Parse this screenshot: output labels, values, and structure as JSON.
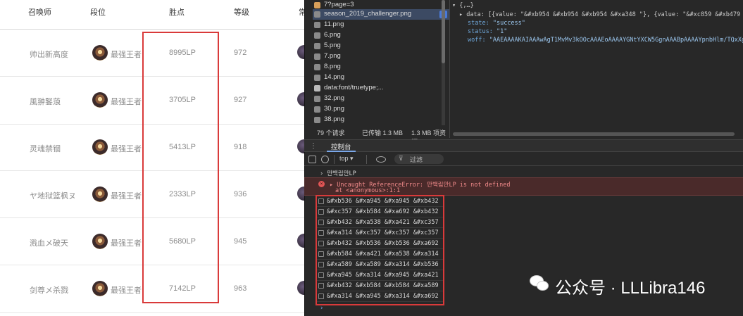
{
  "table": {
    "headers": [
      "召唤师",
      "段位",
      "胜点",
      "等级",
      "常"
    ],
    "rows": [
      {
        "name": "帅出新高度",
        "tier": "最强王者",
        "lp": "8995LP",
        "level": "972"
      },
      {
        "name": "風翀鋻蒗",
        "tier": "最强王者",
        "lp": "3705LP",
        "level": "927"
      },
      {
        "name": "灵魂禁锢",
        "tier": "最强王者",
        "lp": "5413LP",
        "level": "918"
      },
      {
        "name": "ヤ地狱篮枫ヌ",
        "tier": "最强王者",
        "lp": "2333LP",
        "level": "936"
      },
      {
        "name": "溅血メ破天",
        "tier": "最强王者",
        "lp": "5680LP",
        "level": "945"
      },
      {
        "name": "剑尊メ杀戮",
        "tier": "最强王者",
        "lp": "7142LP",
        "level": "963"
      }
    ]
  },
  "network": {
    "items": [
      {
        "name": "7?page=3",
        "icon": "request-icon"
      },
      {
        "name": "season_2019_challenger.png",
        "icon": "image-icon",
        "selected": true
      },
      {
        "name": "11.png",
        "icon": "image-icon"
      },
      {
        "name": "6.png",
        "icon": "image-icon"
      },
      {
        "name": "5.png",
        "icon": "image-icon"
      },
      {
        "name": "7.png",
        "icon": "image-icon"
      },
      {
        "name": "8.png",
        "icon": "image-icon"
      },
      {
        "name": "14.png",
        "icon": "image-icon"
      },
      {
        "name": "data:font/truetype;...",
        "icon": "font-icon"
      },
      {
        "name": "32.png",
        "icon": "image-icon"
      },
      {
        "name": "30.png",
        "icon": "image-icon"
      },
      {
        "name": "38.png",
        "icon": "image-icon"
      }
    ],
    "status": {
      "requests": "79 个请求",
      "transferred": "已传输 1.3 MB",
      "resources": "1.3 MB 项资源"
    }
  },
  "preview": {
    "root": "▾ {,…}",
    "data_line": "▸ data: [{value: \"&#xb954 &#xb954 &#xb954 &#xa348 \"}, {value: \"&#xc859 &#xb479 &#xc4",
    "state_key": "state:",
    "state_val": "\"success\"",
    "status_key": "status:",
    "status_val": "\"1\"",
    "woff_key": "woff:",
    "woff_val": "\"AAEAAAAKAIAAAwAgT1MvMv3kOOcAAAEoAAAAYGNtYXCW5GgnAAABpAAAAYpnbHlm/TQxXgAAA@g"
  },
  "drawer": {
    "menu": "⋮",
    "tab": "控制台"
  },
  "toolbar": {
    "context": "top ▾",
    "filter": "过滤"
  },
  "console": {
    "echo": "› 만백림만LP",
    "error_line1": "▸ Uncaught ReferenceError: 만백림만LP is not defined",
    "error_line2": "  at <anonymous>:1:1",
    "logs": [
      "&#xb536 &#xa945 &#xa945 &#xb432",
      "&#xc357 &#xb584 &#xa692 &#xb432",
      "&#xb432 &#xa538 &#xa421 &#xc357",
      "&#xa314 &#xc357 &#xc357 &#xc357",
      "&#xb432 &#xb536 &#xb536 &#xa692",
      "&#xb584 &#xa421 &#xa538 &#xa314",
      "&#xa589 &#xa589 &#xa314 &#xb536",
      "&#xa945 &#xa314 &#xa945 &#xa421",
      "&#xb432 &#xb584 &#xb584 &#xa589",
      "&#xa314 &#xa945 &#xa314 &#xa692"
    ],
    "prompt": "›"
  },
  "watermark": {
    "text": "公众号 · LLLibra146"
  },
  "colors": {
    "highlight": "#d93a3a",
    "devtools_bg": "#282828",
    "link_blue": "#7aa7e8"
  }
}
